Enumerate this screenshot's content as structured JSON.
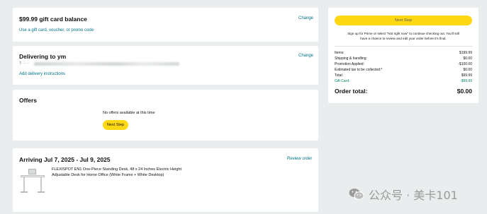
{
  "gift": {
    "title": "$99.99 gift card balance",
    "use_link": "Use a gift card, voucher, or promo code",
    "change": "Change"
  },
  "delivery": {
    "title": "Delivering to ym",
    "address_prefix": "7· ·· ··",
    "instructions": "Add delivery instructions",
    "change": "Change"
  },
  "offers": {
    "title": "Offers",
    "none_text": "No offers available at this time",
    "next_step": "Next Step"
  },
  "arriving": {
    "title": "Arriving Jul 7, 2025 - Jul 9, 2025",
    "review": "Review order",
    "product_line1": "FLEXISPOT EN1 One-Piece Standing Desk, 48 x 24 Inches Electric Height",
    "product_line2": "Adjustable Desk for Home Office (White Frame + White Desktop)"
  },
  "summary": {
    "next_step": "Next Step",
    "prime_note_line1": "Sign up for Prime or select \"Not right now\" to continue checking out. You'll still",
    "prime_note_line2": "have a chance to review and edit your order before it's final.",
    "rows": [
      {
        "label": "Items:",
        "value": "$199.99",
        "green": false
      },
      {
        "label": "Shipping & handling:",
        "value": "$0.00",
        "green": false
      },
      {
        "label": "Promotion Applied:",
        "value": "-$100.00",
        "green": false
      },
      {
        "label": "Estimated tax to be collected:*",
        "value": "$0.00",
        "green": false
      },
      {
        "label": "Total:",
        "value": "$99.99",
        "green": false
      },
      {
        "label": "Gift Card:",
        "value": "-$99.99",
        "green": true
      }
    ],
    "order_total_label": "Order total:",
    "order_total_value": "$0.00"
  },
  "watermark": {
    "text": "公众号 · 美卡101"
  },
  "colors": {
    "page_bg": "#eaeded",
    "link": "#007185",
    "button": "#ffd814",
    "green": "#067d62"
  }
}
